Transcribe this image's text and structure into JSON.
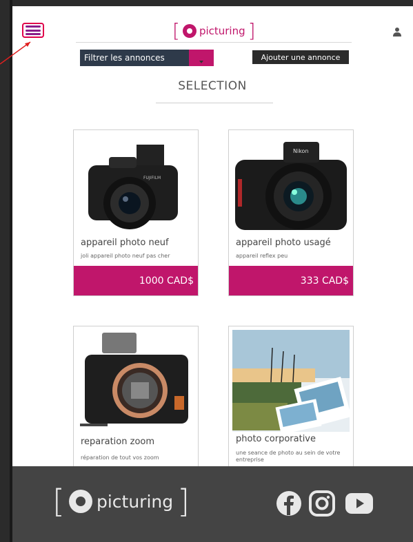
{
  "header": {
    "logo_text": "picturing",
    "filter_label": "Filtrer les annonces",
    "add_label": "Ajouter une annonce"
  },
  "section": {
    "title": "SELECTION"
  },
  "cards": [
    {
      "title": "appareil photo neuf",
      "desc": "joli appareil photo neuf pas cher",
      "price": "1000 CAD$"
    },
    {
      "title": "appareil photo usagé",
      "desc": "appareil reflex peu",
      "price": "333 CAD$"
    },
    {
      "title": "reparation zoom",
      "desc": "réparation de tout vos zoom",
      "price": ""
    },
    {
      "title": "photo corporative",
      "desc": "une seance de photo au sein de votre entreprise",
      "price": ""
    }
  ],
  "footer": {
    "logo_text": "picturing"
  },
  "colors": {
    "accent": "#c0166b",
    "dark": "#2b2b2b",
    "footer": "#444444"
  },
  "icons": [
    "menu-icon",
    "user-icon",
    "chevron-down-icon",
    "facebook-icon",
    "instagram-icon",
    "youtube-icon"
  ]
}
